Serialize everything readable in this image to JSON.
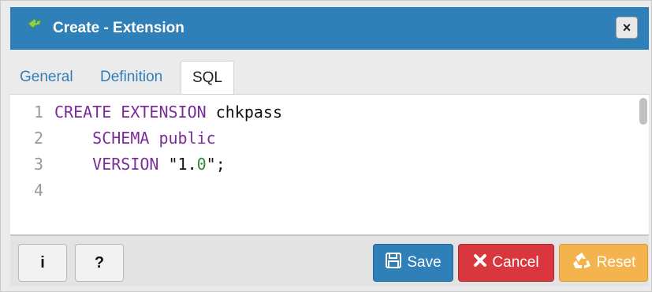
{
  "dialog": {
    "title": "Create - Extension",
    "close_label": "×"
  },
  "tabs": [
    {
      "label": "General"
    },
    {
      "label": "Definition"
    },
    {
      "label": "SQL"
    }
  ],
  "active_tab": "SQL",
  "editor": {
    "line_numbers": [
      "1",
      "2",
      "3",
      "4"
    ],
    "code_lines": [
      [
        {
          "t": "CREATE EXTENSION",
          "c": "kw"
        },
        {
          "t": " chkpass",
          "c": ""
        }
      ],
      [
        {
          "t": "    SCHEMA",
          "c": "kw"
        },
        {
          "t": " public",
          "c": "kw"
        }
      ],
      [
        {
          "t": "    VERSION",
          "c": "kw"
        },
        {
          "t": " \"1.",
          "c": ""
        },
        {
          "t": "0",
          "c": "num"
        },
        {
          "t": "\";",
          "c": ""
        }
      ],
      []
    ]
  },
  "footer": {
    "info_label": "i",
    "help_label": "?",
    "save_label": "Save",
    "cancel_label": "Cancel",
    "reset_label": "Reset"
  },
  "colors": {
    "titlebar": "#2f7fb9",
    "keyword": "#7a2d9a",
    "number": "#2f8a3b",
    "save": "#2f7fb9",
    "cancel": "#d9363e",
    "reset": "#f4b34d"
  },
  "icons": {
    "title": "elephant-icon",
    "save": "floppy-disk-icon",
    "cancel": "x-icon",
    "reset": "recycle-icon"
  }
}
